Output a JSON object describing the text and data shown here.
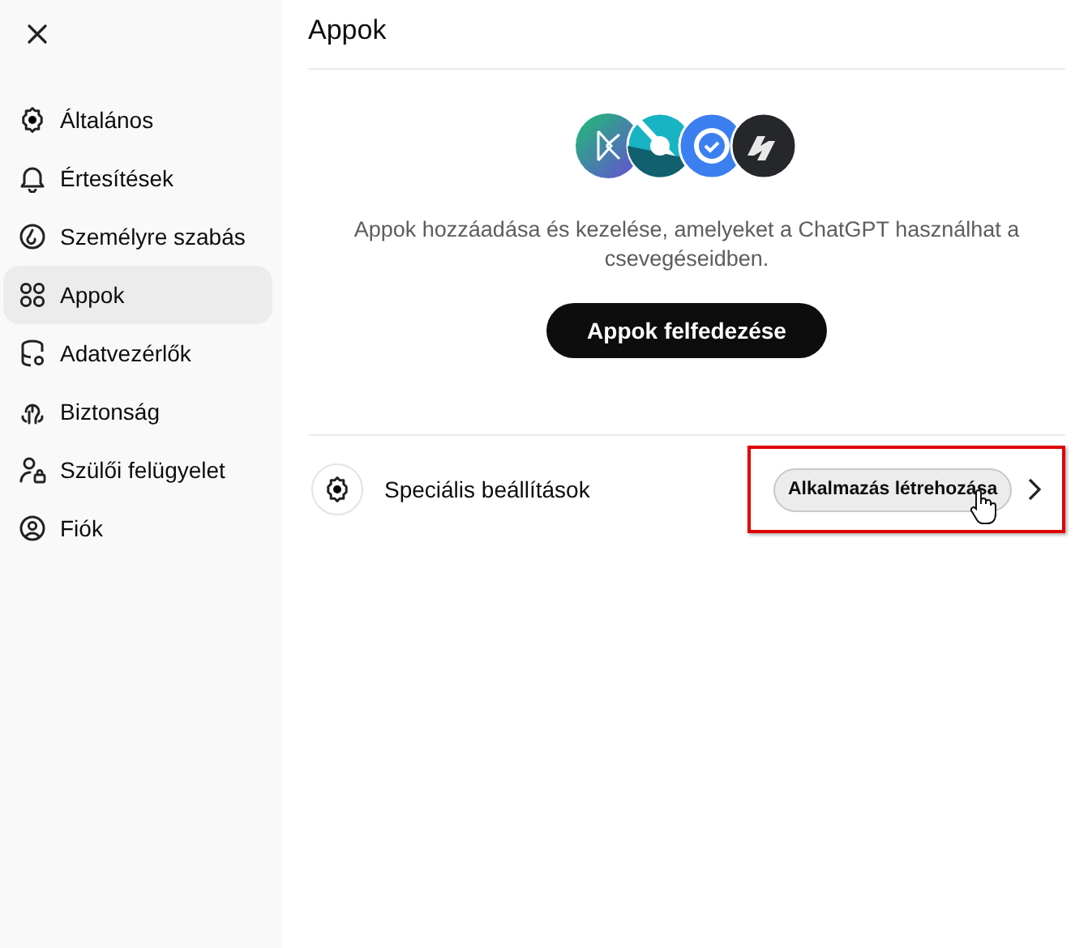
{
  "sidebar": {
    "items": [
      {
        "label": "Általános",
        "selected": false
      },
      {
        "label": "Értesítések",
        "selected": false
      },
      {
        "label": "Személyre szabás",
        "selected": false
      },
      {
        "label": "Appok",
        "selected": true
      },
      {
        "label": "Adatvezérlők",
        "selected": false
      },
      {
        "label": "Biztonság",
        "selected": false
      },
      {
        "label": "Szülői felügyelet",
        "selected": false
      },
      {
        "label": "Fiók",
        "selected": false
      }
    ]
  },
  "main": {
    "title": "Appok",
    "description": "Appok hozzáadása és kezelése, amelyeket a ChatGPT használhat a csevegéseidben.",
    "discover_button": "Appok felfedezése",
    "advanced": {
      "label": "Speciális beállítások",
      "button": "Alkalmazás létrehozása"
    }
  }
}
